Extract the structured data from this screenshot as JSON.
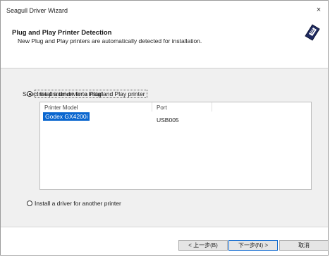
{
  "window": {
    "title": "Seagull Driver Wizard",
    "close_glyph": "×"
  },
  "header": {
    "title": "Plug and Play Printer Detection",
    "subtitle": "New Plug and Play printers are automatically detected for installation.",
    "logo_icon": "seagull-wizard-logo-icon"
  },
  "content": {
    "instruction": "Select the printer driver to install",
    "options": [
      {
        "label": "Install a driver for a Plug and Play printer",
        "checked": true
      },
      {
        "label": "Install a driver for another printer",
        "checked": false
      }
    ],
    "listview": {
      "columns": [
        "Printer Model",
        "Port"
      ],
      "rows": [
        {
          "model": "Godex GX4200i",
          "port": "USB005",
          "selected": true
        }
      ]
    }
  },
  "buttons": {
    "back": "< 上一步(B)",
    "next": "下一步(N) >",
    "cancel": "取消"
  }
}
